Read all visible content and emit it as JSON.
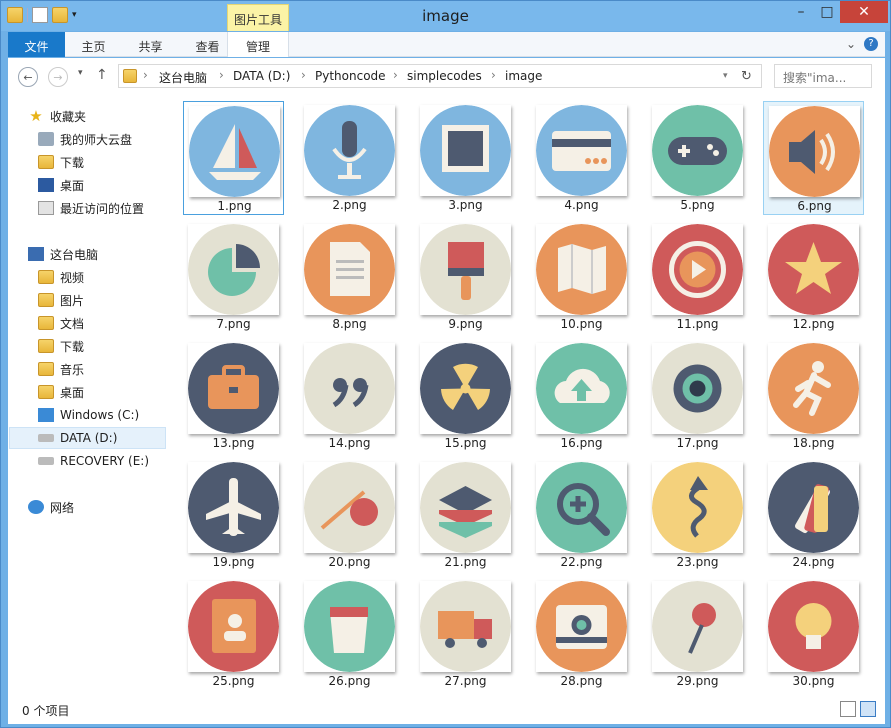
{
  "window": {
    "title": "image",
    "context_tab": "图片工具"
  },
  "ribbon": {
    "tabs": [
      "文件",
      "主页",
      "共享",
      "查看",
      "管理"
    ]
  },
  "address": {
    "crumbs": [
      "这台电脑",
      "DATA (D:)",
      "Pythoncode",
      "simplecodes",
      "image"
    ],
    "search_placeholder": "搜索\"ima..."
  },
  "nav": {
    "favorites_label": "收藏夹",
    "favorites": [
      "我的师大云盘",
      "下载",
      "桌面",
      "最近访问的位置"
    ],
    "pc_label": "这台电脑",
    "pc_items": [
      "视频",
      "图片",
      "文档",
      "下载",
      "音乐",
      "桌面",
      "Windows (C:)",
      "DATA (D:)",
      "RECOVERY (E:)"
    ],
    "network_label": "网络",
    "selected": "DATA (D:)"
  },
  "files": [
    {
      "name": "1.png",
      "icon": "sailboat-icon",
      "bg": "#7fb6df"
    },
    {
      "name": "2.png",
      "icon": "microphone-icon",
      "bg": "#7fb6df"
    },
    {
      "name": "3.png",
      "icon": "photo-frame-icon",
      "bg": "#7fb6df"
    },
    {
      "name": "4.png",
      "icon": "credit-card-icon",
      "bg": "#7fb6df"
    },
    {
      "name": "5.png",
      "icon": "gamepad-icon",
      "bg": "#6fc0a8"
    },
    {
      "name": "6.png",
      "icon": "speaker-icon",
      "bg": "#e8955b"
    },
    {
      "name": "7.png",
      "icon": "pie-chart-icon",
      "bg": "#e3e1d2"
    },
    {
      "name": "8.png",
      "icon": "document-icon",
      "bg": "#e8955b"
    },
    {
      "name": "9.png",
      "icon": "paint-brush-icon",
      "bg": "#e3e1d2"
    },
    {
      "name": "10.png",
      "icon": "map-icon",
      "bg": "#e8955b"
    },
    {
      "name": "11.png",
      "icon": "play-button-icon",
      "bg": "#cf5a5a"
    },
    {
      "name": "12.png",
      "icon": "star-icon",
      "bg": "#cf5a5a"
    },
    {
      "name": "13.png",
      "icon": "briefcase-icon",
      "bg": "#4e5a70"
    },
    {
      "name": "14.png",
      "icon": "quote-icon",
      "bg": "#e3e1d2"
    },
    {
      "name": "15.png",
      "icon": "radiation-icon",
      "bg": "#4e5a70"
    },
    {
      "name": "16.png",
      "icon": "cloud-upload-icon",
      "bg": "#6fc0a8"
    },
    {
      "name": "17.png",
      "icon": "camera-lens-icon",
      "bg": "#e3e1d2"
    },
    {
      "name": "18.png",
      "icon": "runner-icon",
      "bg": "#e8955b"
    },
    {
      "name": "19.png",
      "icon": "airplane-icon",
      "bg": "#4e5a70"
    },
    {
      "name": "20.png",
      "icon": "bindle-icon",
      "bg": "#e3e1d2"
    },
    {
      "name": "21.png",
      "icon": "layers-icon",
      "bg": "#e3e1d2"
    },
    {
      "name": "22.png",
      "icon": "zoom-in-icon",
      "bg": "#6fc0a8"
    },
    {
      "name": "23.png",
      "icon": "winding-arrow-icon",
      "bg": "#f4d17c"
    },
    {
      "name": "24.png",
      "icon": "color-swatch-icon",
      "bg": "#4e5a70"
    },
    {
      "name": "25.png",
      "icon": "address-book-icon",
      "bg": "#cf5a5a"
    },
    {
      "name": "26.png",
      "icon": "paint-bucket-icon",
      "bg": "#6fc0a8"
    },
    {
      "name": "27.png",
      "icon": "truck-icon",
      "bg": "#e3e1d2"
    },
    {
      "name": "28.png",
      "icon": "instant-camera-icon",
      "bg": "#e8955b"
    },
    {
      "name": "29.png",
      "icon": "pin-icon",
      "bg": "#e3e1d2"
    },
    {
      "name": "30.png",
      "icon": "lightbulb-icon",
      "bg": "#cf5a5a"
    }
  ],
  "status": {
    "text": "0 个项目"
  }
}
